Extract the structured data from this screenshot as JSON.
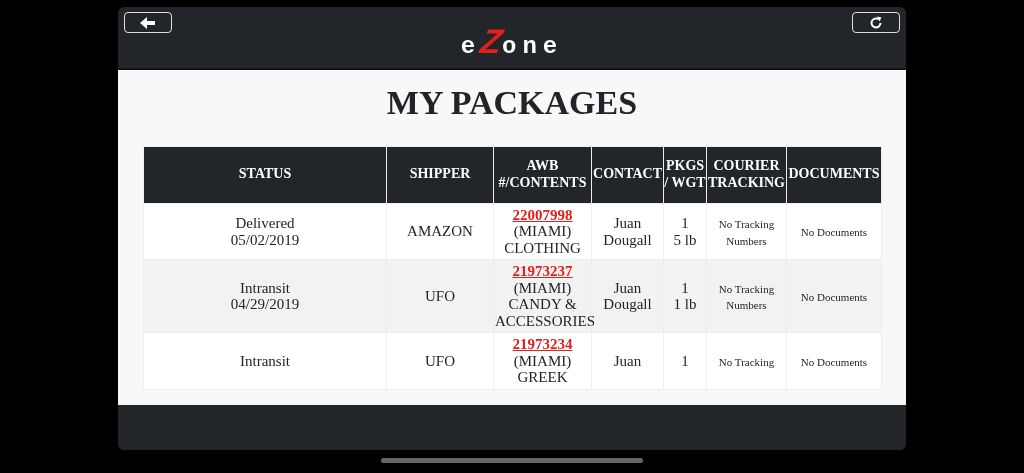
{
  "header": {
    "logo": {
      "lead": "e",
      "accent": "Z",
      "rest": "one"
    }
  },
  "title": "MY PACKAGES",
  "table": {
    "columns": [
      "STATUS",
      "SHIPPER",
      "AWB #/CONTENTS",
      "CONTACT",
      "PKGS / WGT",
      "COURIER TRACKING",
      "DOCUMENTS"
    ],
    "rows": [
      {
        "status": [
          "Delivered",
          "05/02/2019"
        ],
        "shipper": "AMAZON",
        "awb": "22007998",
        "contents": [
          "(MIAMI)",
          "CLOTHING"
        ],
        "contact": [
          "Juan",
          "Dougall"
        ],
        "pkgs_wgt": [
          "1",
          "5 lb"
        ],
        "courier_tracking": [
          "No Tracking",
          "Numbers"
        ],
        "documents": "No Documents"
      },
      {
        "status": [
          "Intransit",
          "04/29/2019"
        ],
        "shipper": "UFO",
        "awb": "21973237",
        "contents": [
          "(MIAMI)",
          "CANDY &",
          "ACCESSORIES"
        ],
        "contact": [
          "Juan",
          "Dougall"
        ],
        "pkgs_wgt": [
          "1",
          "1 lb"
        ],
        "courier_tracking": [
          "No Tracking",
          "Numbers"
        ],
        "documents": "No Documents"
      },
      {
        "status": [
          "Intransit"
        ],
        "shipper": "UFO",
        "awb": "21973234",
        "contents": [
          "(MIAMI)",
          "GREEK"
        ],
        "contact": [
          "Juan"
        ],
        "pkgs_wgt": [
          "1"
        ],
        "courier_tracking": [
          "No Tracking"
        ],
        "documents": "No Documents"
      }
    ]
  }
}
